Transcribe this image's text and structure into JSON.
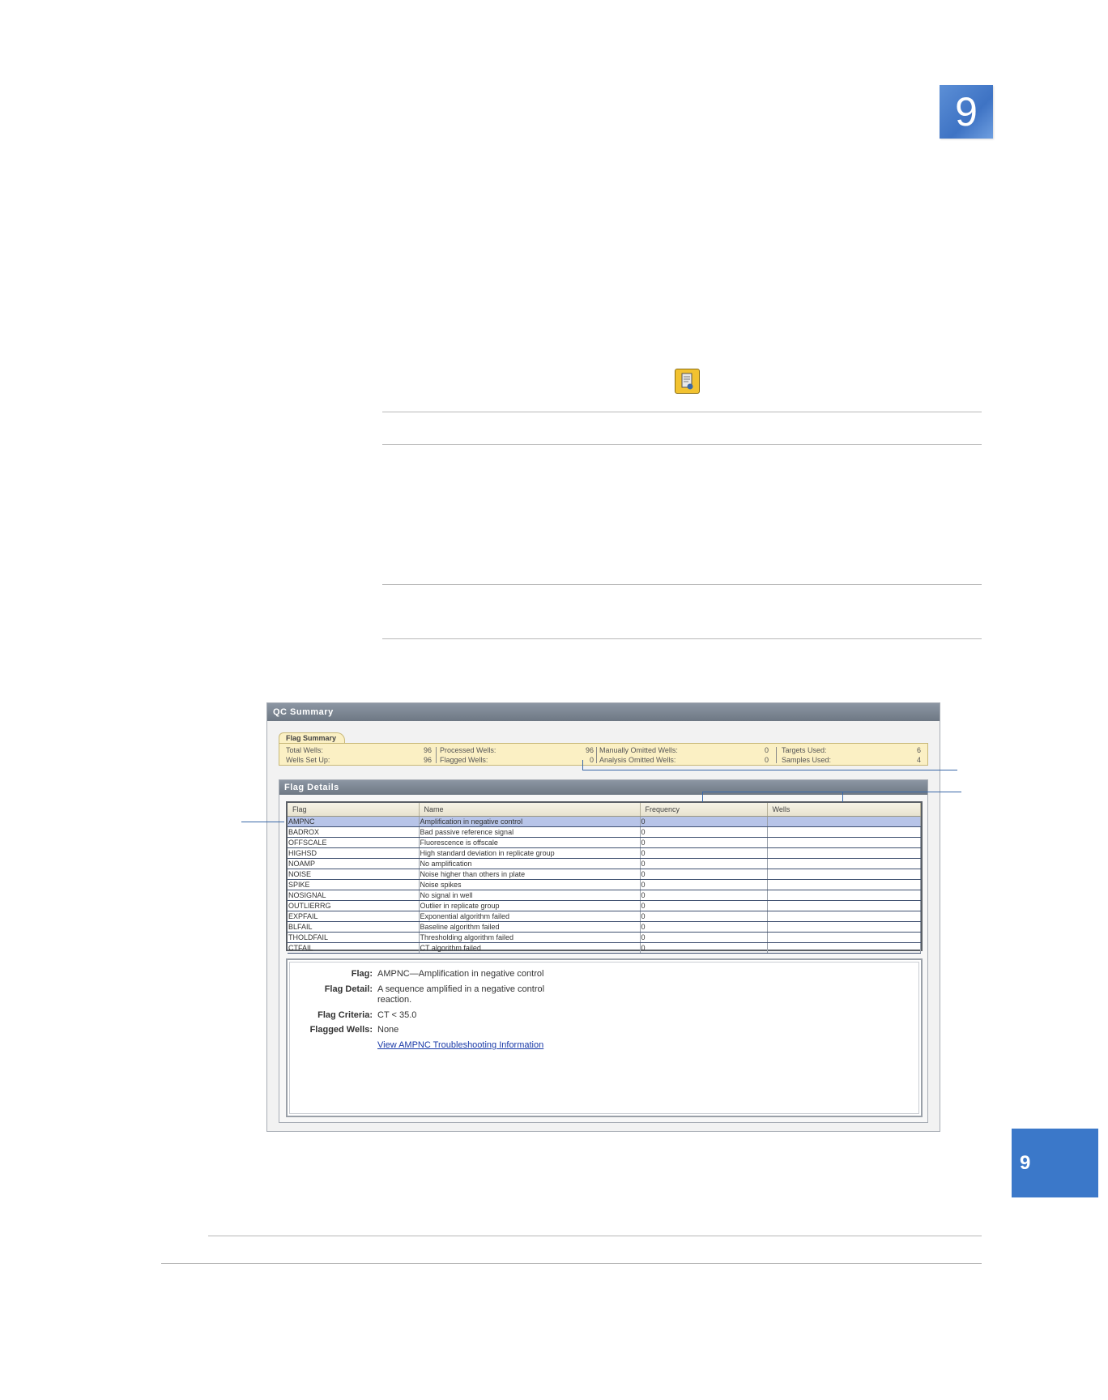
{
  "chapter": {
    "number": "9"
  },
  "side_tab": {
    "number": "9"
  },
  "icons": {
    "report": "report-document-icon"
  },
  "qc_summary": {
    "title": "QC Summary",
    "flag_summary": {
      "tab_label": "Flag Summary",
      "col1": [
        {
          "label": "Total Wells:",
          "value": "96"
        },
        {
          "label": "Wells Set Up:",
          "value": "96"
        }
      ],
      "col2": [
        {
          "label": "Processed Wells:",
          "value": "96"
        },
        {
          "label": "Flagged Wells:",
          "value": "0"
        }
      ],
      "col3": [
        {
          "label": "Manually Omitted Wells:",
          "value": "0"
        },
        {
          "label": "Analysis Omitted Wells:",
          "value": "0"
        }
      ],
      "col4": [
        {
          "label": "Targets Used:",
          "value": "6"
        },
        {
          "label": "Samples Used:",
          "value": "4"
        }
      ]
    },
    "flag_details": {
      "title": "Flag Details",
      "columns": [
        "Flag",
        "Name",
        "Frequency",
        "Wells"
      ],
      "rows": [
        {
          "flag": "AMPNC",
          "name": "Amplification in negative control",
          "frequency": "0",
          "wells": ""
        },
        {
          "flag": "BADROX",
          "name": "Bad passive reference signal",
          "frequency": "0",
          "wells": ""
        },
        {
          "flag": "OFFSCALE",
          "name": "Fluorescence is offscale",
          "frequency": "0",
          "wells": ""
        },
        {
          "flag": "HIGHSD",
          "name": "High standard deviation in replicate group",
          "frequency": "0",
          "wells": ""
        },
        {
          "flag": "NOAMP",
          "name": "No amplification",
          "frequency": "0",
          "wells": ""
        },
        {
          "flag": "NOISE",
          "name": "Noise higher than others in plate",
          "frequency": "0",
          "wells": ""
        },
        {
          "flag": "SPIKE",
          "name": "Noise spikes",
          "frequency": "0",
          "wells": ""
        },
        {
          "flag": "NOSIGNAL",
          "name": "No signal in well",
          "frequency": "0",
          "wells": ""
        },
        {
          "flag": "OUTLIERRG",
          "name": "Outlier in replicate group",
          "frequency": "0",
          "wells": ""
        },
        {
          "flag": "EXPFAIL",
          "name": "Exponential algorithm failed",
          "frequency": "0",
          "wells": ""
        },
        {
          "flag": "BLFAIL",
          "name": "Baseline algorithm failed",
          "frequency": "0",
          "wells": ""
        },
        {
          "flag": "THOLDFAIL",
          "name": "Thresholding algorithm failed",
          "frequency": "0",
          "wells": ""
        },
        {
          "flag": "CTFAIL",
          "name": "CT algorithm failed",
          "frequency": "0",
          "wells": ""
        }
      ],
      "selected_row": 0,
      "detail": {
        "flag_label": "Flag:",
        "flag_value": "AMPNC—Amplification in negative control",
        "detail_label": "Flag Detail:",
        "detail_value_line1": "A sequence amplified in a negative control",
        "detail_value_line2": "reaction.",
        "criteria_label": "Flag Criteria:",
        "criteria_value": "CT < 35.0",
        "flagged_wells_label": "Flagged Wells:",
        "flagged_wells_value": "None",
        "link_text": "View AMPNC Troubleshooting Information"
      }
    }
  },
  "colors": {
    "chapter_blue": "#3e73c4",
    "side_tab_blue": "#3b78c9",
    "flag_summary_bg": "#fbf0c4",
    "selected_row": "#b7c4e8",
    "link": "#1a3aa8",
    "callout": "#3a68a8"
  }
}
